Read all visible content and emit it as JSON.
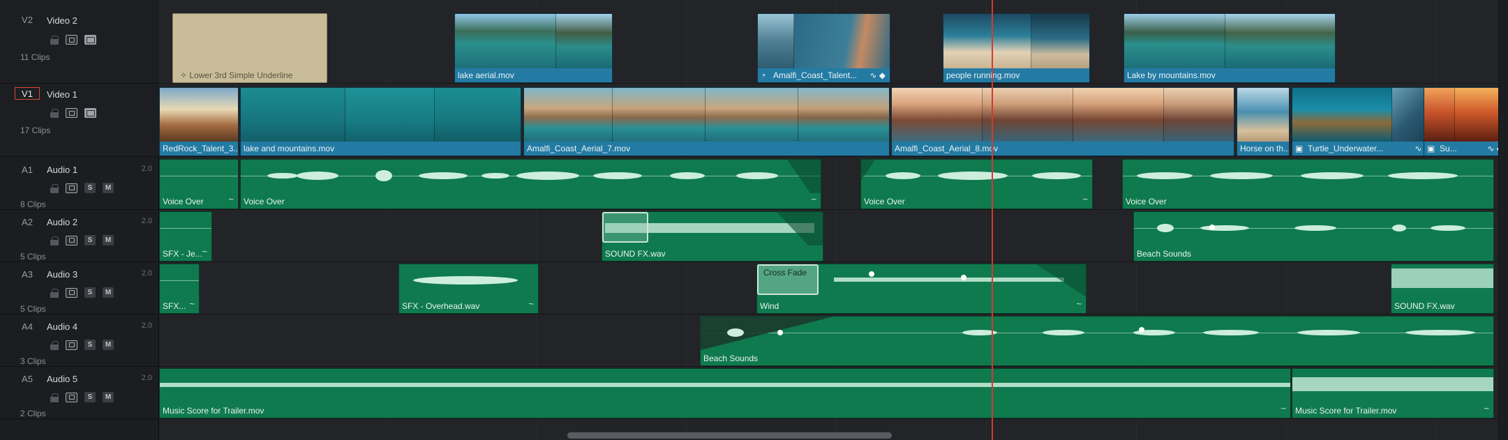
{
  "tracks": [
    {
      "id": "V2",
      "name": "Video 2",
      "clips": "11 Clips",
      "type": "video"
    },
    {
      "id": "V1",
      "name": "Video 1",
      "clips": "17 Clips",
      "type": "video",
      "active": true
    },
    {
      "id": "A1",
      "name": "Audio 1",
      "volume": "2.0",
      "clips": "8 Clips",
      "type": "audio"
    },
    {
      "id": "A2",
      "name": "Audio 2",
      "volume": "2.0",
      "clips": "5 Clips",
      "type": "audio"
    },
    {
      "id": "A3",
      "name": "Audio 3",
      "volume": "2.0",
      "clips": "5 Clips",
      "type": "audio"
    },
    {
      "id": "A4",
      "name": "Audio 4",
      "volume": "2.0",
      "clips": "3 Clips",
      "type": "audio"
    },
    {
      "id": "A5",
      "name": "Audio 5",
      "volume": "2.0",
      "clips": "2 Clips",
      "type": "audio"
    }
  ],
  "audio_buttons": {
    "solo": "S",
    "mute": "M"
  },
  "v2_clips": {
    "lower_third": "Lower 3rd Simple Underline",
    "lake_aerial": "lake aerial.mov",
    "amalfi_talent": "Amalfi_Coast_Talent...",
    "people_running": "people running.mov",
    "lake_mountains": "Lake by mountains.mov"
  },
  "v1_clips": {
    "redrock": "RedRock_Talent_3...",
    "lake_and_mountains": "lake and mountains.mov",
    "amalfi_7": "Amalfi_Coast_Aerial_7.mov",
    "amalfi_8": "Amalfi_Coast_Aerial_8.mov",
    "horse": "Horse on th...",
    "turtle": "Turtle_Underwater...",
    "last": "Su..."
  },
  "a1_clips": {
    "c1": "Voice Over",
    "c2": "Voice Over",
    "c3": "Voice Over",
    "c4": "Voice Over"
  },
  "a2_clips": {
    "c1": "SFX - Je...",
    "c2": "SOUND FX.wav",
    "c3": "Beach Sounds"
  },
  "a3_clips": {
    "c1": "SFX...",
    "c2": "SFX - Overhead.wav",
    "c3": "Wind",
    "c4": "SOUND FX.wav"
  },
  "a4_clips": {
    "c1": "Beach Sounds"
  },
  "a5_clips": {
    "c1": "Music Score for Trailer.mov",
    "c2": "Music Score for Trailer.mov"
  },
  "transitions": {
    "cross_fade": "Cross Fade"
  },
  "icons": {
    "curve": "~",
    "lock": "lock-icon",
    "auto_select": "auto-select-icon",
    "clip_toggle": "clip-toggle-icon"
  },
  "colors": {
    "video_clip": "#237ba3",
    "audio_clip": "#0f7a4e",
    "playhead": "#d43a2c",
    "track_active": "#d6483b",
    "generator_clip": "#c8bd98"
  }
}
